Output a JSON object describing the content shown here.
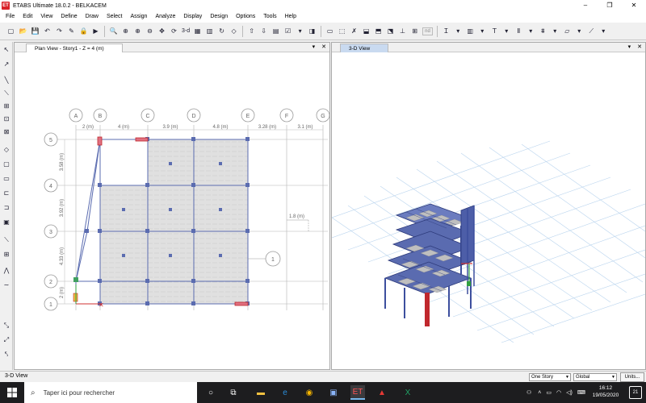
{
  "window": {
    "title": "ETABS Ultimate 18.0.2 - BELKACEM",
    "logo_text": "ET",
    "controls": [
      "–",
      "❐",
      "✕"
    ]
  },
  "menu": [
    "File",
    "Edit",
    "View",
    "Define",
    "Draw",
    "Select",
    "Assign",
    "Analyze",
    "Display",
    "Design",
    "Options",
    "Tools",
    "Help"
  ],
  "toolbar": {
    "view_3d_label": "3-d",
    "nd_label": "nd"
  },
  "plan_view": {
    "tab_label": "Plan View - Story1 - Z = 4 (m)",
    "grid_letters": [
      "A",
      "B",
      "C",
      "D",
      "E",
      "F",
      "G"
    ],
    "grid_numbers": [
      "5",
      "4",
      "3",
      "2",
      "1"
    ],
    "x_spacings": [
      "2 (m)",
      "4 (m)",
      "3.9 (m)",
      "4.8 (m)",
      "3.28 (m)",
      "3.1 (m)"
    ],
    "y_spacings": [
      "3.58 (m)",
      "3.92 (m)",
      "4.33 (m)",
      "2 (m)"
    ],
    "dim_note": "1.8 (m)",
    "section_marker": "1"
  },
  "view_3d": {
    "tab_label": "3-D View"
  },
  "statusbar": {
    "left_text": "3-D View",
    "story_select": "One Story",
    "coord_select": "Global",
    "units_button": "Units..."
  },
  "taskbar": {
    "search_placeholder": "Taper ici pour rechercher",
    "clock_time": "16:12",
    "clock_date": "19/05/2020",
    "notification_count": "21"
  },
  "colors": {
    "grid_line": "#b4b4b4",
    "beam_blue": "#5b6cb0",
    "slab_fill": "#e0e0e0",
    "frame_3d": "#3d4f9e",
    "column_red": "#c0282d",
    "floor_grid": "#b9d4ee",
    "taskbar": "#1d1d1f"
  }
}
